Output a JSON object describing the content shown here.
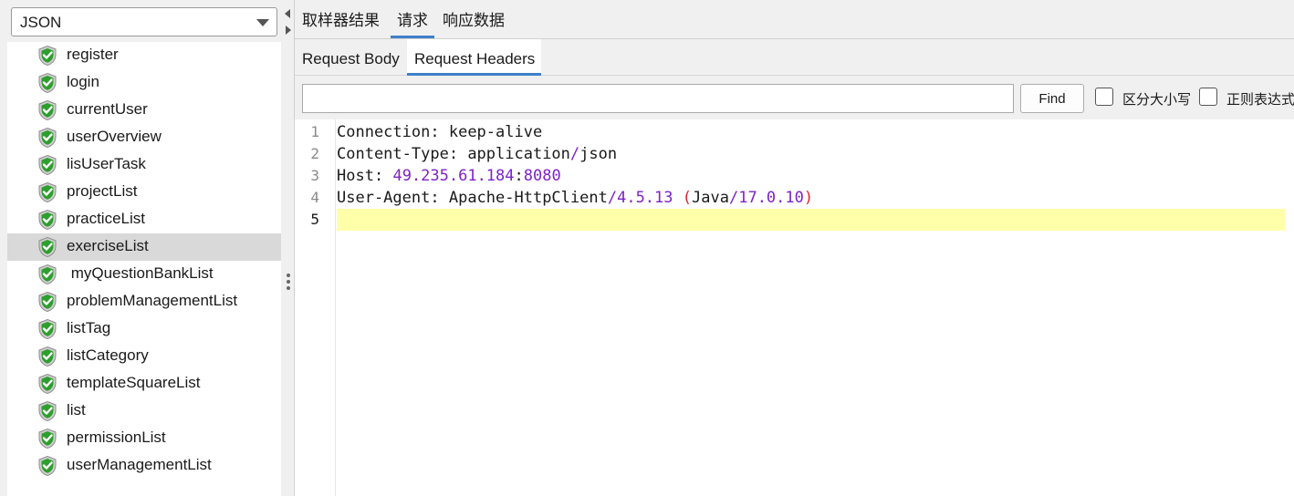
{
  "left_panel": {
    "renderer_selector": {
      "value": "JSON"
    },
    "results": [
      {
        "label": "register",
        "status": "success"
      },
      {
        "label": "login",
        "status": "success"
      },
      {
        "label": "currentUser",
        "status": "success"
      },
      {
        "label": "userOverview",
        "status": "success"
      },
      {
        "label": "lisUserTask",
        "status": "success"
      },
      {
        "label": "projectList",
        "status": "success"
      },
      {
        "label": "practiceList",
        "status": "success"
      },
      {
        "label": "exerciseList",
        "status": "success",
        "selected": true
      },
      {
        "label": " myQuestionBankList",
        "status": "success"
      },
      {
        "label": "problemManagementList",
        "status": "success"
      },
      {
        "label": "listTag",
        "status": "success"
      },
      {
        "label": "listCategory",
        "status": "success"
      },
      {
        "label": "templateSquareList",
        "status": "success"
      },
      {
        "label": "list",
        "status": "success"
      },
      {
        "label": "permissionList",
        "status": "success"
      },
      {
        "label": "userManagementList",
        "status": "success"
      }
    ]
  },
  "main_tabs": [
    {
      "label": "取样器结果",
      "active": false
    },
    {
      "label": "请求",
      "active": true
    },
    {
      "label": "响应数据",
      "active": false
    }
  ],
  "sub_tabs": [
    {
      "label": "Request Body",
      "active": false
    },
    {
      "label": "Request Headers",
      "active": true
    }
  ],
  "find_bar": {
    "input_value": "",
    "find_label": "Find",
    "case_sensitive_label": "区分大小写",
    "case_sensitive_checked": false,
    "regex_label": "正则表达式",
    "regex_checked": false
  },
  "editor": {
    "current_line": 5,
    "lines": [
      {
        "number": "1",
        "text": "Connection: keep-alive"
      },
      {
        "number": "2",
        "text": "Content-Type: application/json"
      },
      {
        "number": "3",
        "text": "Host: 49.235.61.184:8080"
      },
      {
        "number": "4",
        "text": "User-Agent: Apache-HttpClient/4.5.13 (Java/17.0.10)"
      },
      {
        "number": "5",
        "text": ""
      }
    ]
  },
  "colors": {
    "accent_tab_underline": "#3f7fc9",
    "current_line_highlight": "#ffffaa",
    "number_token": "#7f22c9",
    "paren_token": "#e0252c",
    "success_shield": "#2e9e2e"
  },
  "icons": {
    "result_status": "green-shield-check-icon",
    "dropdown": "chevron-down-icon",
    "splitter": "split-arrows-icon"
  }
}
